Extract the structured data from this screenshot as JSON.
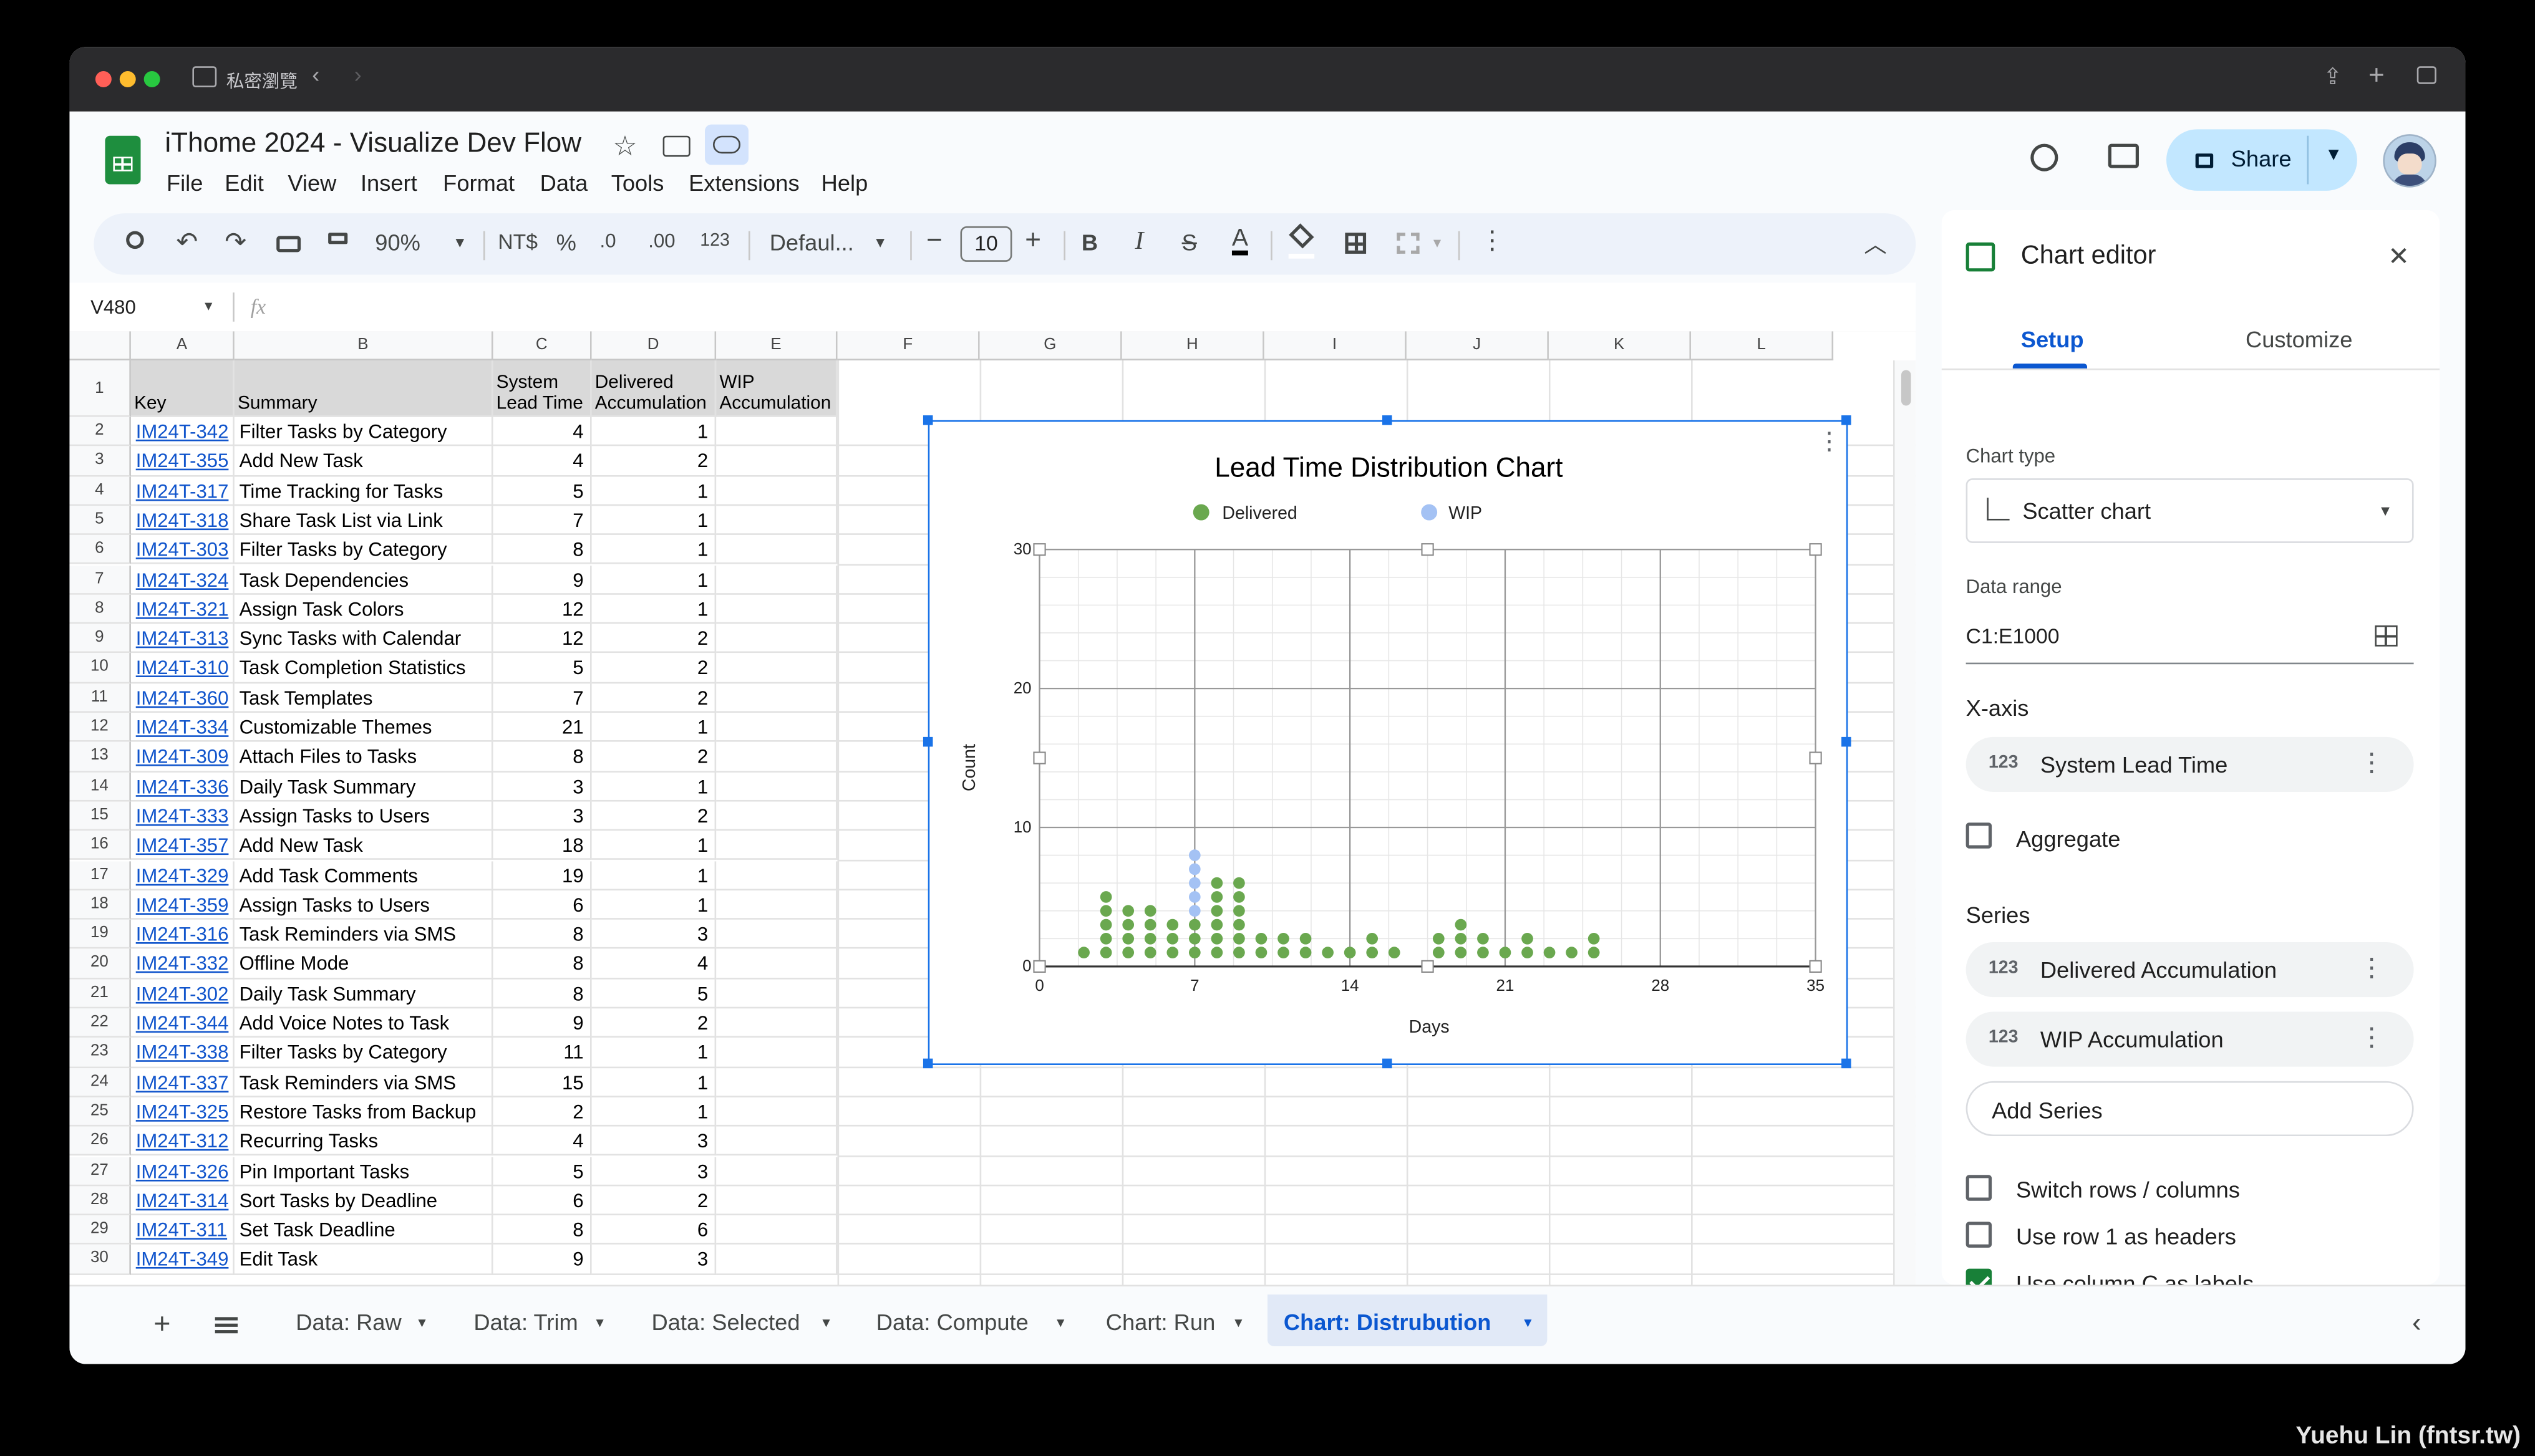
{
  "browser": {
    "tab_label": "私密瀏覽"
  },
  "app": {
    "title": "iThome 2024 - Visualize Dev Flow",
    "menus": [
      "File",
      "Edit",
      "View",
      "Insert",
      "Format",
      "Data",
      "Tools",
      "Extensions",
      "Help"
    ],
    "share_label": "Share"
  },
  "toolbar": {
    "zoom": "90%",
    "currency": "NT$",
    "percent": "%",
    "dec_minus": ".0",
    "dec_plus": ".00",
    "number_format": "123",
    "font": "Defaul...",
    "font_size": "10",
    "bold": "B",
    "italic": "I",
    "strike": "S",
    "text_color": "A"
  },
  "formula_bar": {
    "cell_ref": "V480",
    "fx": "fx",
    "formula": ""
  },
  "sheet": {
    "columns": [
      "A",
      "B",
      "C",
      "D",
      "E",
      "F",
      "G",
      "H",
      "I",
      "J",
      "K",
      "L"
    ],
    "header_row": [
      "Key",
      "Summary",
      "System Lead Time",
      "Delivered Accumulation",
      "WIP Accumulation"
    ],
    "rows": [
      [
        "2",
        "IM24T-342",
        "Filter Tasks by Category",
        "4",
        "1"
      ],
      [
        "3",
        "IM24T-355",
        "Add New Task",
        "4",
        "2"
      ],
      [
        "4",
        "IM24T-317",
        "Time Tracking for Tasks",
        "5",
        "1"
      ],
      [
        "5",
        "IM24T-318",
        "Share Task List via Link",
        "7",
        "1"
      ],
      [
        "6",
        "IM24T-303",
        "Filter Tasks by Category",
        "8",
        "1"
      ],
      [
        "7",
        "IM24T-324",
        "Task Dependencies",
        "9",
        "1"
      ],
      [
        "8",
        "IM24T-321",
        "Assign Task Colors",
        "12",
        "1"
      ],
      [
        "9",
        "IM24T-313",
        "Sync Tasks with Calendar",
        "12",
        "2"
      ],
      [
        "10",
        "IM24T-310",
        "Task Completion Statistics",
        "5",
        "2"
      ],
      [
        "11",
        "IM24T-360",
        "Task Templates",
        "7",
        "2"
      ],
      [
        "12",
        "IM24T-334",
        "Customizable Themes",
        "21",
        "1"
      ],
      [
        "13",
        "IM24T-309",
        "Attach Files to Tasks",
        "8",
        "2"
      ],
      [
        "14",
        "IM24T-336",
        "Daily Task Summary",
        "3",
        "1"
      ],
      [
        "15",
        "IM24T-333",
        "Assign Tasks to Users",
        "3",
        "2"
      ],
      [
        "16",
        "IM24T-357",
        "Add New Task",
        "18",
        "1"
      ],
      [
        "17",
        "IM24T-329",
        "Add Task Comments",
        "19",
        "1"
      ],
      [
        "18",
        "IM24T-359",
        "Assign Tasks to Users",
        "6",
        "1"
      ],
      [
        "19",
        "IM24T-316",
        "Task Reminders via SMS",
        "8",
        "3"
      ],
      [
        "20",
        "IM24T-332",
        "Offline Mode",
        "8",
        "4"
      ],
      [
        "21",
        "IM24T-302",
        "Daily Task Summary",
        "8",
        "5"
      ],
      [
        "22",
        "IM24T-344",
        "Add Voice Notes to Task",
        "9",
        "2"
      ],
      [
        "23",
        "IM24T-338",
        "Filter Tasks by Category",
        "11",
        "1"
      ],
      [
        "24",
        "IM24T-337",
        "Task Reminders via SMS",
        "15",
        "1"
      ],
      [
        "25",
        "IM24T-325",
        "Restore Tasks from Backup",
        "2",
        "1"
      ],
      [
        "26",
        "IM24T-312",
        "Recurring Tasks",
        "4",
        "3"
      ],
      [
        "27",
        "IM24T-326",
        "Pin Important Tasks",
        "5",
        "3"
      ],
      [
        "28",
        "IM24T-314",
        "Sort Tasks by Deadline",
        "6",
        "2"
      ],
      [
        "29",
        "IM24T-311",
        "Set Task Deadline",
        "8",
        "6"
      ],
      [
        "30",
        "IM24T-349",
        "Edit Task",
        "9",
        "3"
      ]
    ]
  },
  "chart_data": {
    "type": "scatter",
    "title": "Lead Time Distribution Chart",
    "xlabel": "Days",
    "ylabel": "Count",
    "xlim": [
      0,
      35
    ],
    "ylim": [
      0,
      30
    ],
    "xticks": [
      "0",
      "7",
      "14",
      "21",
      "28",
      "35"
    ],
    "yticks": [
      "0",
      "10",
      "20",
      "30"
    ],
    "legend_position": "top",
    "series": [
      {
        "name": "Delivered",
        "color": "#6aa84f",
        "points": [
          [
            2,
            1
          ],
          [
            3,
            1
          ],
          [
            3,
            2
          ],
          [
            3,
            3
          ],
          [
            3,
            4
          ],
          [
            3,
            5
          ],
          [
            4,
            1
          ],
          [
            4,
            2
          ],
          [
            4,
            3
          ],
          [
            4,
            4
          ],
          [
            5,
            1
          ],
          [
            5,
            2
          ],
          [
            5,
            3
          ],
          [
            5,
            4
          ],
          [
            6,
            1
          ],
          [
            6,
            2
          ],
          [
            6,
            3
          ],
          [
            7,
            1
          ],
          [
            7,
            2
          ],
          [
            7,
            3
          ],
          [
            8,
            1
          ],
          [
            8,
            2
          ],
          [
            8,
            3
          ],
          [
            8,
            4
          ],
          [
            8,
            5
          ],
          [
            8,
            6
          ],
          [
            9,
            1
          ],
          [
            9,
            2
          ],
          [
            9,
            3
          ],
          [
            9,
            4
          ],
          [
            9,
            5
          ],
          [
            9,
            6
          ],
          [
            10,
            1
          ],
          [
            10,
            2
          ],
          [
            11,
            1
          ],
          [
            11,
            2
          ],
          [
            12,
            1
          ],
          [
            12,
            2
          ],
          [
            13,
            1
          ],
          [
            14,
            1
          ],
          [
            15,
            1
          ],
          [
            15,
            2
          ],
          [
            16,
            1
          ],
          [
            18,
            1
          ],
          [
            18,
            2
          ],
          [
            19,
            1
          ],
          [
            19,
            2
          ],
          [
            19,
            3
          ],
          [
            20,
            1
          ],
          [
            20,
            2
          ],
          [
            21,
            1
          ],
          [
            22,
            1
          ],
          [
            22,
            2
          ],
          [
            23,
            1
          ],
          [
            24,
            1
          ],
          [
            25,
            1
          ],
          [
            25,
            2
          ]
        ]
      },
      {
        "name": "WIP",
        "color": "#a4c2f4",
        "points": [
          [
            7,
            4
          ],
          [
            7,
            5
          ],
          [
            7,
            6
          ],
          [
            7,
            7
          ],
          [
            7,
            8
          ]
        ]
      }
    ]
  },
  "editor": {
    "title": "Chart editor",
    "tabs": [
      "Setup",
      "Customize"
    ],
    "chart_type_label": "Chart type",
    "chart_type_value": "Scatter chart",
    "data_range_label": "Data range",
    "data_range_value": "C1:E1000",
    "xaxis_label": "X-axis",
    "xaxis_value": "System Lead Time",
    "aggregate_label": "Aggregate",
    "series_label": "Series",
    "series": [
      "Delivered Accumulation",
      "WIP Accumulation"
    ],
    "add_series": "Add Series",
    "options": [
      {
        "label": "Switch rows / columns",
        "checked": false
      },
      {
        "label": "Use row 1 as headers",
        "checked": false
      },
      {
        "label": "Use column C as labels",
        "checked": true
      }
    ],
    "icon_123": "123"
  },
  "sheet_tabs": [
    "Data: Raw",
    "Data: Trim",
    "Data: Selected",
    "Data: Compute",
    "Chart: Run",
    "Chart: Distrubution"
  ],
  "active_tab": "Chart: Distrubution",
  "watermark": "Yuehu Lin (fntsr.tw)"
}
